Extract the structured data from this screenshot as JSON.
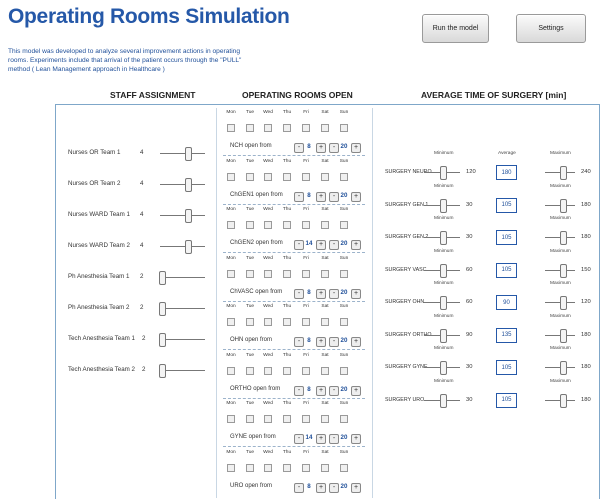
{
  "header": {
    "title": "Operating Rooms Simulation",
    "description": "This model was developed  to analyze several improvement actions in operating rooms. Experiments include that arrival of the patient occurs through the  \"PULL\" method ( Lean Management approach  in Healthcare  )",
    "run_label": "Run the model",
    "settings_label": "Settings"
  },
  "staff": {
    "heading": "STAFF ASSIGNMENT",
    "rows": [
      {
        "label": "Nurses OR Team 1",
        "value": "4"
      },
      {
        "label": "Nurses OR Team 2",
        "value": "4"
      },
      {
        "label": "Nurses WARD Team 1",
        "value": "4"
      },
      {
        "label": "Nurses WARD Team 2",
        "value": "4"
      },
      {
        "label": "Ph Anesthesia Team 1",
        "value": "2"
      },
      {
        "label": "Ph Anesthesia Team 2",
        "value": "2"
      },
      {
        "label": "Tech Anesthesia Team 1",
        "value": "2"
      },
      {
        "label": "Tech Anesthesia Team 2",
        "value": "2"
      }
    ]
  },
  "rooms": {
    "heading": "OPERATING ROOMS OPEN",
    "days": [
      "Mon",
      "Tue",
      "Wed",
      "Thu",
      "Fri",
      "Sat",
      "Sun"
    ],
    "rows": [
      {
        "label": "NCH open from",
        "from": "8",
        "to": "20"
      },
      {
        "label": "ChGEN1 open from",
        "from": "8",
        "to": "20"
      },
      {
        "label": "ChGEN2 open from",
        "from": "14",
        "to": "20"
      },
      {
        "label": "ChVASC open from",
        "from": "8",
        "to": "20"
      },
      {
        "label": "OHN open from",
        "from": "8",
        "to": "20"
      },
      {
        "label": "ORTHO open from",
        "from": "8",
        "to": "20"
      },
      {
        "label": "GYNE open from",
        "from": "14",
        "to": "20"
      },
      {
        "label": "URO open from",
        "from": "8",
        "to": "20"
      }
    ],
    "minus": "-",
    "plus": "+"
  },
  "surgery": {
    "heading": "AVERAGE TIME OF SURGERY [min]",
    "min_label": "Minimum",
    "avg_label": "Average",
    "max_label": "Maximum",
    "rows": [
      {
        "name": "SURGERY NEURO",
        "min": "120",
        "avg": "180",
        "max": "240"
      },
      {
        "name": "SURGERY GEN 1",
        "min": "30",
        "avg": "105",
        "max": "180"
      },
      {
        "name": "SURGERY GEN 2",
        "min": "30",
        "avg": "105",
        "max": "180"
      },
      {
        "name": "SURGERY VASC",
        "min": "60",
        "avg": "105",
        "max": "150"
      },
      {
        "name": "SURGERY OHN",
        "min": "60",
        "avg": "90",
        "max": "120"
      },
      {
        "name": "SURGERY ORTHO",
        "min": "90",
        "avg": "135",
        "max": "180"
      },
      {
        "name": "SURGERY GYNE",
        "min": "30",
        "avg": "105",
        "max": "180"
      },
      {
        "name": "SURGERY URO",
        "min": "30",
        "avg": "105",
        "max": "180"
      }
    ]
  }
}
